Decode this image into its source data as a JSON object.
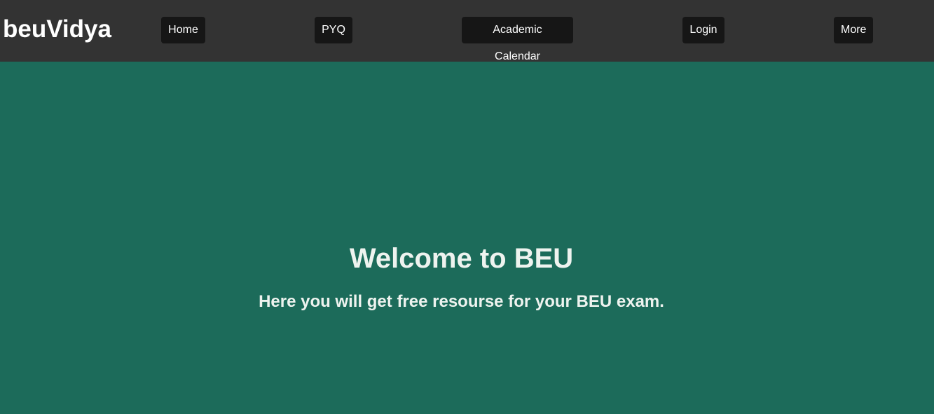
{
  "header": {
    "brand": "beuVidya",
    "nav": {
      "home": "Home",
      "pyq": "PYQ",
      "academic_calendar": "Academic Calendar",
      "login": "Login",
      "more": "More"
    }
  },
  "hero": {
    "title": "Welcome to BEU",
    "subtitle": "Here you will get free resourse for your BEU exam."
  },
  "colors": {
    "navbar_bg": "#333333",
    "nav_button_bg": "#161616",
    "hero_bg": "#1c6b5a",
    "hero_text": "#eef3ef"
  }
}
